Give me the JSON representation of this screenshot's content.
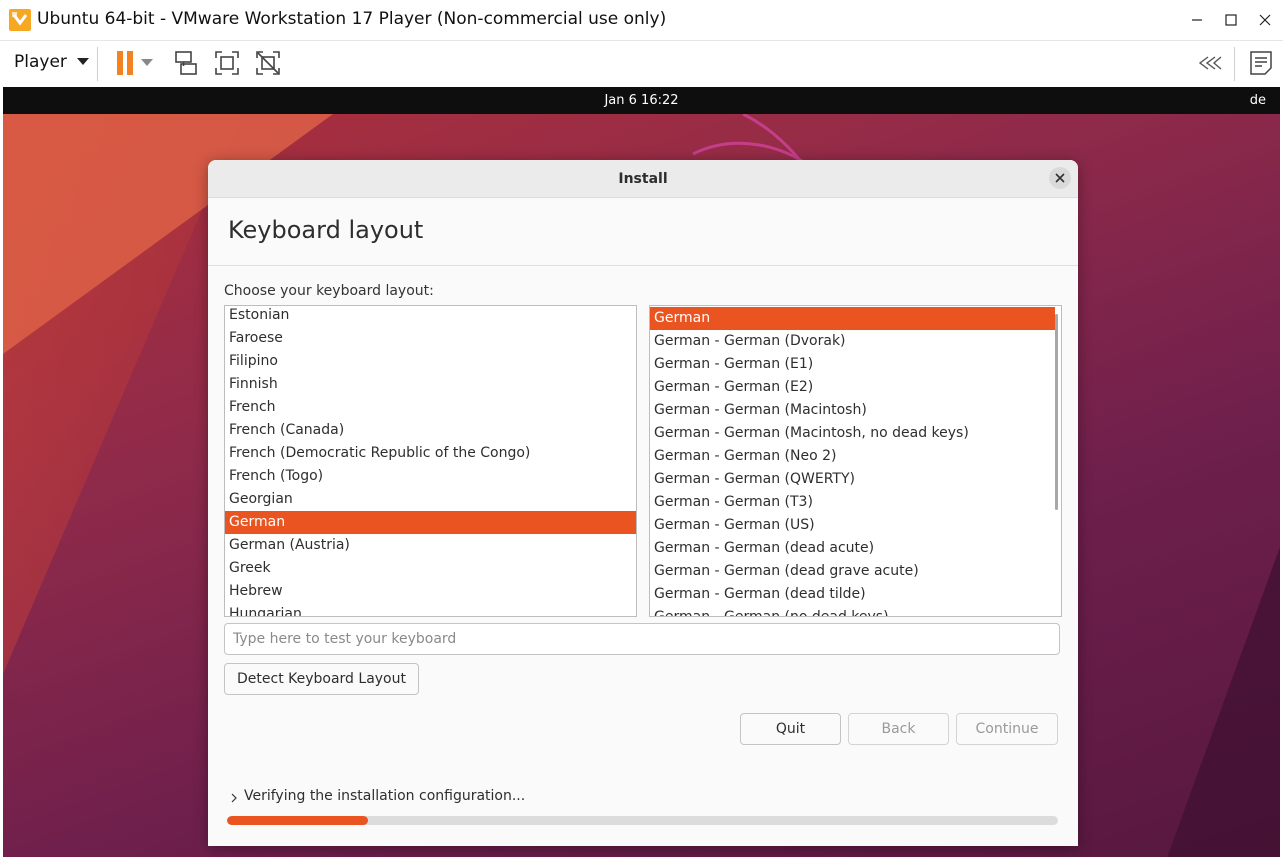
{
  "window": {
    "title": "Ubuntu 64-bit - VMware Workstation 17 Player (Non-commercial use only)",
    "controls": [
      "minimize-icon",
      "maximize-icon",
      "close-icon"
    ]
  },
  "toolbar": {
    "player_menu": "Player",
    "icons": [
      "pause-icon",
      "dropdown-arrow-icon",
      "send-ctrl-alt-del-icon",
      "full-screen-icon",
      "unity-icon",
      "collapse-icon",
      "message-log-icon"
    ]
  },
  "guest": {
    "clock": "Jan 6  16:22",
    "input_source": "de"
  },
  "installer": {
    "window_title": "Install",
    "heading": "Keyboard layout",
    "choose_label": "Choose your keyboard layout:",
    "layouts": [
      "Estonian",
      "Faroese",
      "Filipino",
      "Finnish",
      "French",
      "French (Canada)",
      "French (Democratic Republic of the Congo)",
      "French (Togo)",
      "Georgian",
      "German",
      "German (Austria)",
      "Greek",
      "Hebrew",
      "Hungarian"
    ],
    "selected_layout": "German",
    "variants": [
      "German",
      "German - German (Dvorak)",
      "German - German (E1)",
      "German - German (E2)",
      "German - German (Macintosh)",
      "German - German (Macintosh, no dead keys)",
      "German - German (Neo 2)",
      "German - German (QWERTY)",
      "German - German (T3)",
      "German - German (US)",
      "German - German (dead acute)",
      "German - German (dead grave acute)",
      "German - German (dead tilde)",
      "German - German (no dead keys)"
    ],
    "selected_variant": "German",
    "test_placeholder": "Type here to test your keyboard",
    "test_value": "",
    "detect_button": "Detect Keyboard Layout",
    "quit_button": "Quit",
    "back_button": "Back",
    "continue_button": "Continue",
    "progress_text": "Verifying the installation configuration...",
    "progress_fraction": 0.17
  },
  "colors": {
    "accent": "#e95420",
    "vmware_pause": "#f58220"
  }
}
